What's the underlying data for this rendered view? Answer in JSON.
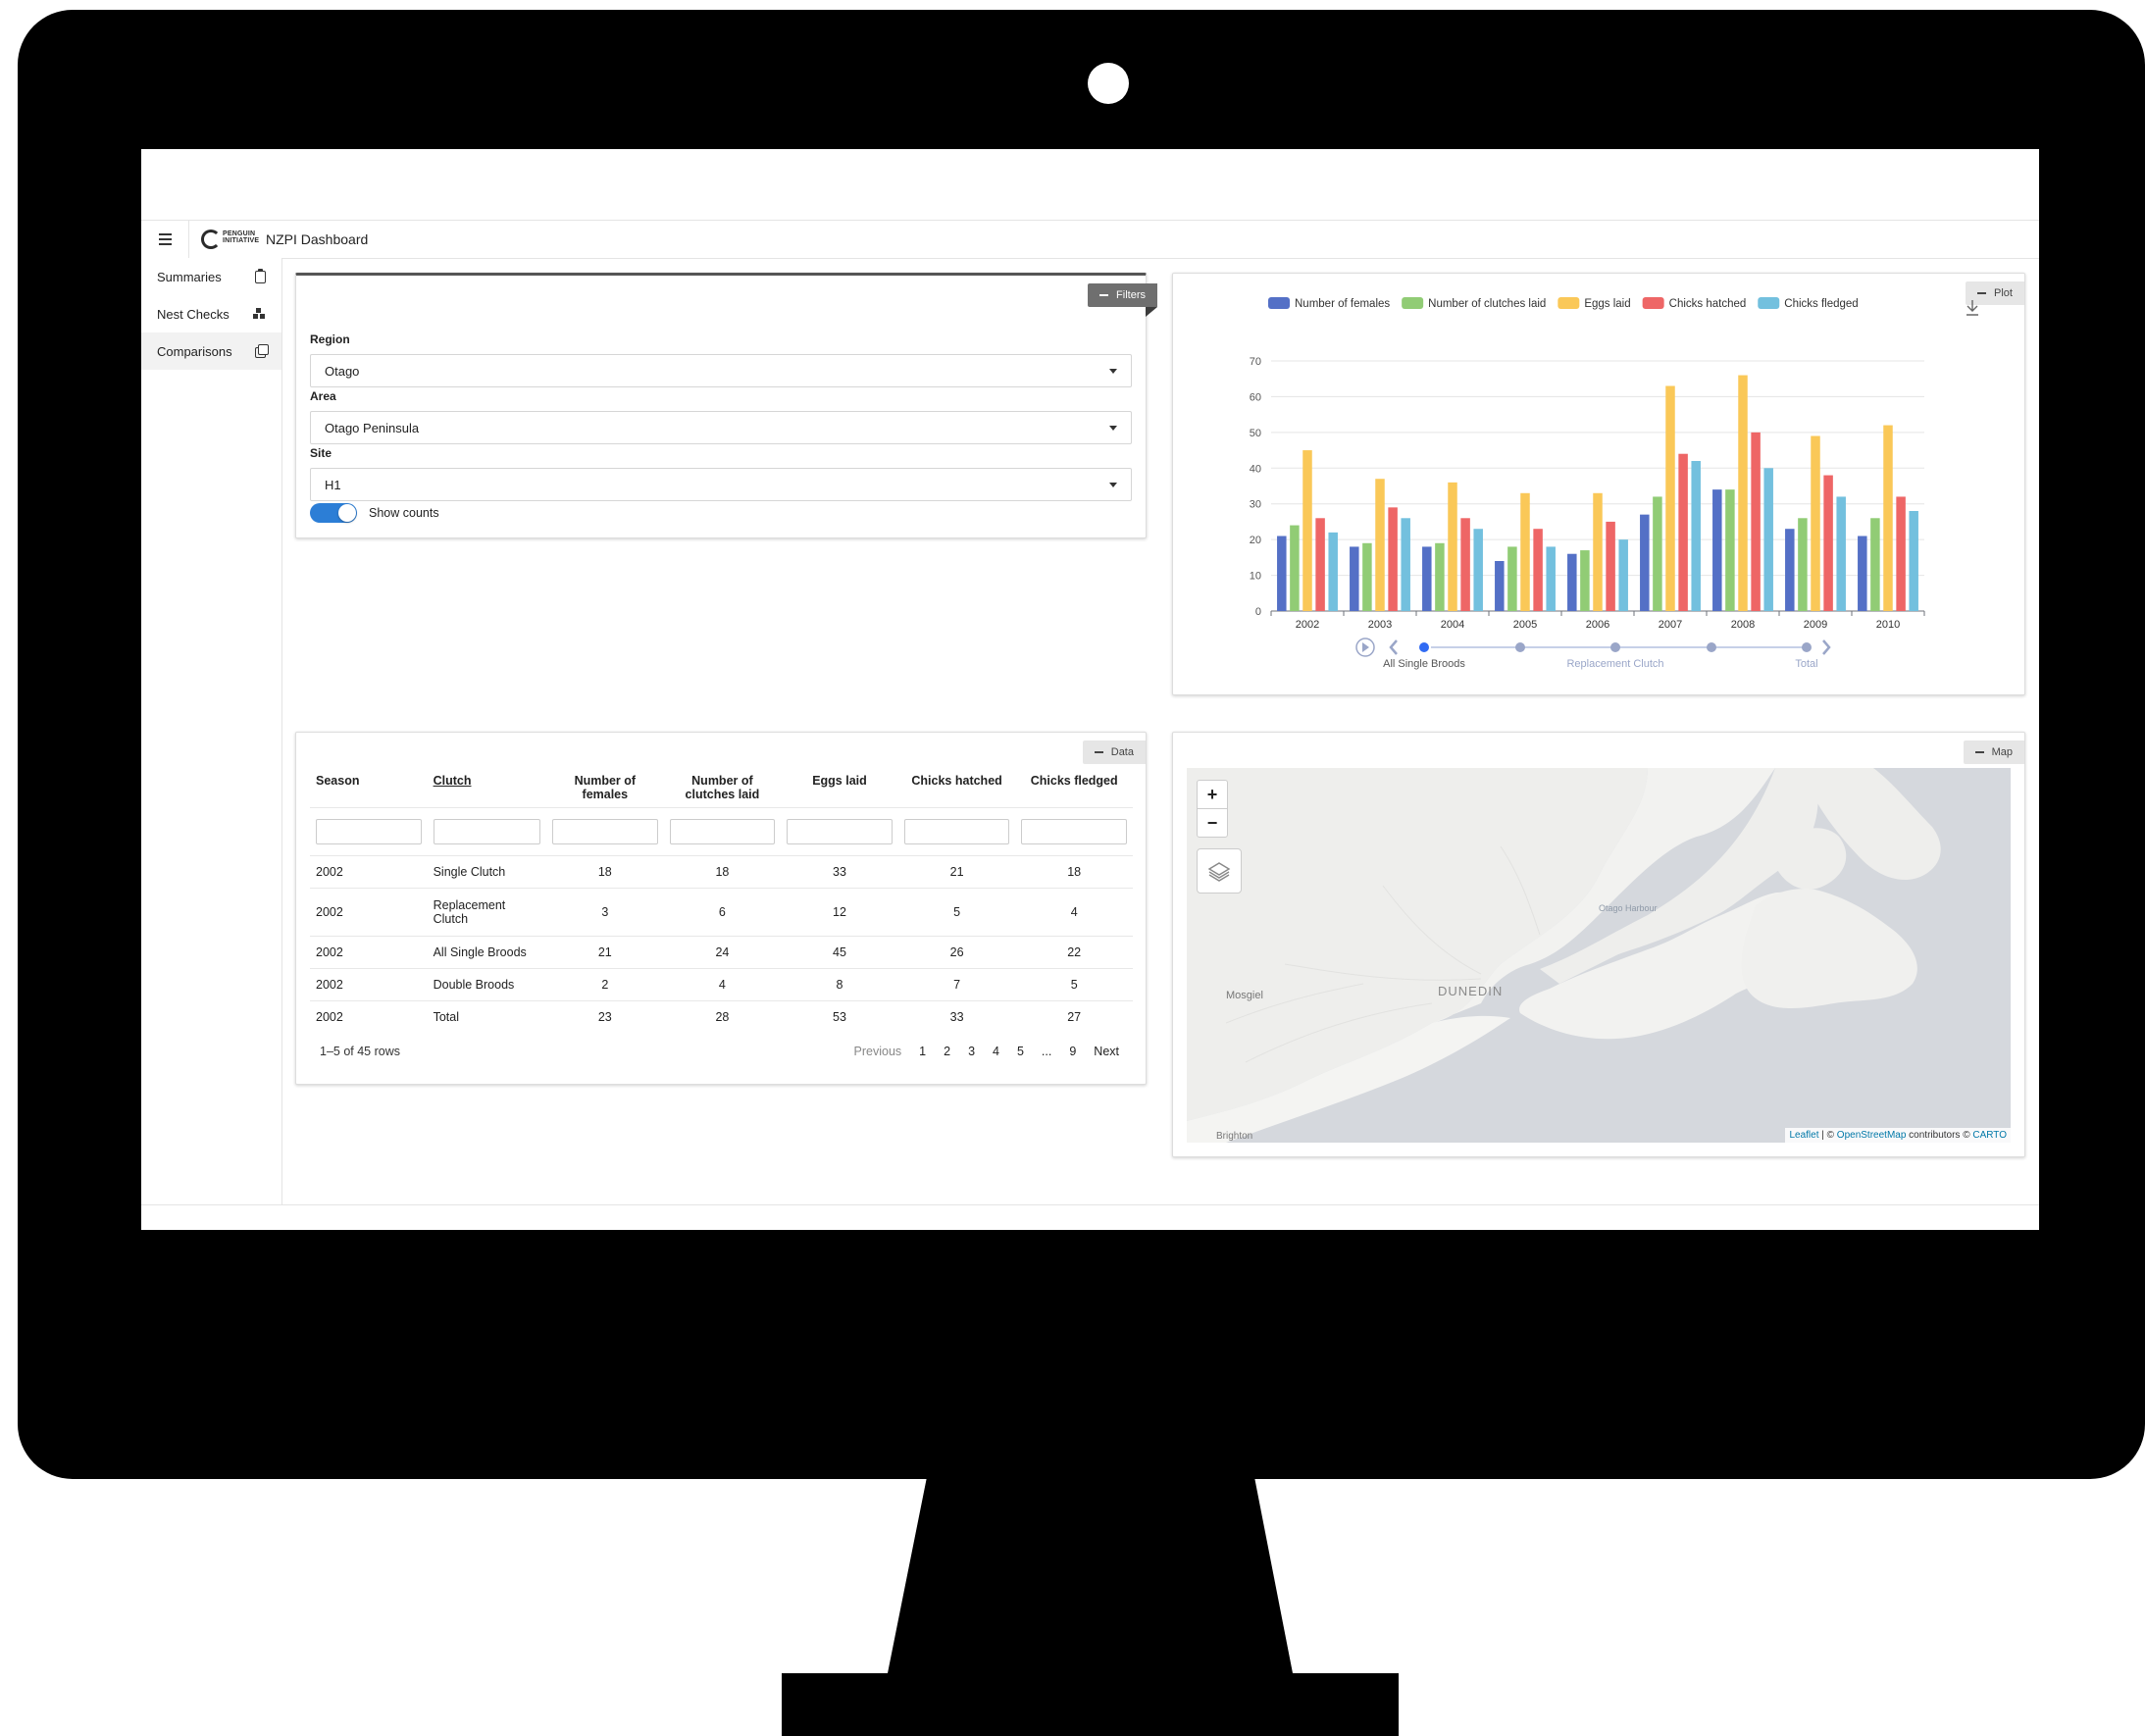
{
  "app": {
    "title": "NZPI Dashboard",
    "logo_text": "PENGUIN INITIATIVE"
  },
  "sidebar": {
    "items": [
      {
        "label": "Summaries",
        "icon": "clipboard-icon"
      },
      {
        "label": "Nest Checks",
        "icon": "blocks-icon"
      },
      {
        "label": "Comparisons",
        "icon": "copy-icon",
        "active": true
      }
    ]
  },
  "filters": {
    "ribbon_label": "Filters",
    "region_label": "Region",
    "region_value": "Otago",
    "area_label": "Area",
    "area_value": "Otago Peninsula",
    "site_label": "Site",
    "site_value": "H1",
    "toggle_label": "Show counts",
    "toggle_on": true
  },
  "plot": {
    "ribbon_label": "Plot",
    "timeline": [
      "All Single Broods",
      "Replacement Clutch",
      "Total"
    ],
    "timeline_active": 0
  },
  "chart_data": {
    "type": "bar",
    "categories": [
      "2002",
      "2003",
      "2004",
      "2005",
      "2006",
      "2007",
      "2008",
      "2009",
      "2010"
    ],
    "series": [
      {
        "name": "Number of females",
        "color": "#5470c6",
        "values": [
          21,
          18,
          18,
          14,
          16,
          27,
          34,
          23,
          21
        ]
      },
      {
        "name": "Number of clutches laid",
        "color": "#91cc75",
        "values": [
          24,
          19,
          19,
          18,
          17,
          32,
          34,
          26,
          26
        ]
      },
      {
        "name": "Eggs laid",
        "color": "#fac858",
        "values": [
          45,
          37,
          36,
          33,
          33,
          63,
          66,
          49,
          52
        ]
      },
      {
        "name": "Chicks hatched",
        "color": "#ee6666",
        "values": [
          26,
          29,
          26,
          23,
          25,
          44,
          50,
          38,
          32
        ]
      },
      {
        "name": "Chicks fledged",
        "color": "#73c0de",
        "values": [
          22,
          26,
          23,
          18,
          20,
          42,
          40,
          32,
          28
        ]
      }
    ],
    "yticks": [
      0,
      10,
      20,
      30,
      40,
      50,
      60,
      70
    ],
    "ylim": [
      0,
      70
    ],
    "legend": "top",
    "grid": true
  },
  "data_table": {
    "ribbon_label": "Data",
    "columns": [
      "Season",
      "Clutch",
      "Number of females",
      "Number of clutches laid",
      "Eggs laid",
      "Chicks hatched",
      "Chicks fledged"
    ],
    "rows": [
      [
        "2002",
        "Single Clutch",
        "18",
        "18",
        "33",
        "21",
        "18"
      ],
      [
        "2002",
        "Replacement Clutch",
        "3",
        "6",
        "12",
        "5",
        "4"
      ],
      [
        "2002",
        "All Single Broods",
        "21",
        "24",
        "45",
        "26",
        "22"
      ],
      [
        "2002",
        "Double Broods",
        "2",
        "4",
        "8",
        "7",
        "5"
      ],
      [
        "2002",
        "Total",
        "23",
        "28",
        "53",
        "33",
        "27"
      ]
    ],
    "row_count": "1–5 of 45 rows",
    "prev_label": "Previous",
    "next_label": "Next",
    "pages": [
      "1",
      "2",
      "3",
      "4",
      "5",
      "...",
      "9"
    ]
  },
  "map": {
    "ribbon_label": "Map",
    "labels": {
      "city": "DUNEDIN",
      "mosgiel": "Mosgiel",
      "harbour": "Otago Harbour",
      "brighton": "Brighton"
    },
    "attribution": {
      "leaflet": "Leaflet",
      "sep": " | © ",
      "osm": "OpenStreetMap",
      "contrib": " contributors © ",
      "carto": "CARTO"
    }
  }
}
